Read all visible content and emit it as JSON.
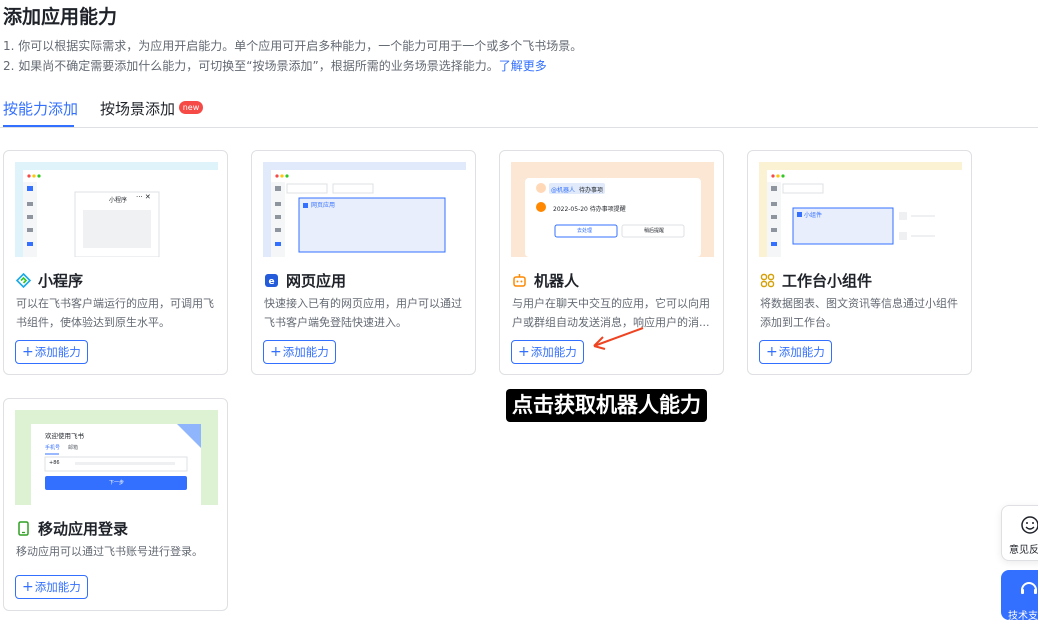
{
  "page": {
    "title": "添加应用能力",
    "desc_line1": "1. 你可以根据实际需求，为应用开启能力。单个应用可开启多种能力，一个能力可用于一个或多个飞书场景。",
    "desc_line2_prefix": "2. 如果尚不确定需要添加什么能力，可切换至“按场景添加”，根据所需的业务场景选择能力。",
    "desc_link": "了解更多"
  },
  "tabs": [
    {
      "label": "按能力添加",
      "active": true
    },
    {
      "label": "按场景添加",
      "active": false,
      "badge": "new"
    }
  ],
  "cards": [
    {
      "title": "小程序",
      "desc": "可以在飞书客户端运行的应用，可调用飞书组件，使体验达到原生水平。",
      "button": "添加能力",
      "icon": "mini-program-icon",
      "thumb_bg": "#dff3fb",
      "thumb": {
        "window_title": "小程序",
        "controls": "··· ✕"
      }
    },
    {
      "title": "网页应用",
      "desc": "快速接入已有的网页应用，用户可以通过飞书客户端免登陆快速进入。",
      "button": "添加能力",
      "icon": "web-app-icon",
      "thumb_bg": "#e1eafa",
      "thumb": {
        "tab_label": "网页应用"
      }
    },
    {
      "title": "机器人",
      "desc": "与用户在聊天中交互的应用，它可以向用户或群组自动发送消息，响应用户的消...",
      "button": "添加能力",
      "icon": "bot-icon",
      "thumb_bg": "#fce6d4",
      "thumb": {
        "header_tag": "@机器人",
        "header_text": "待办事项",
        "message": "2022-05-20 待办事项提醒",
        "btn_primary": "去处理",
        "btn_secondary": "稍后提醒"
      }
    },
    {
      "title": "工作台小组件",
      "desc": "将数据图表、图文资讯等信息通过小组件添加到工作台。",
      "button": "添加能力",
      "icon": "widget-icon",
      "thumb_bg": "#fbf1d3",
      "thumb": {
        "widget_label": "小组件"
      }
    },
    {
      "title": "移动应用登录",
      "desc": "移动应用可以通过飞书账号进行登录。",
      "button": "添加能力",
      "icon": "mobile-login-icon",
      "thumb_bg": "#dcf2d3",
      "thumb": {
        "welcome": "欢迎使用飞书",
        "tab_phone": "手机号",
        "tab_email": "邮箱",
        "country_code": "+86",
        "next_button": "下一步"
      }
    }
  ],
  "annotation": {
    "text": "点击获取机器人能力",
    "arrow_color": "#ee4422"
  },
  "floating": {
    "feedback_label": "意见反",
    "support_label": "技术支"
  },
  "colors": {
    "accent": "#3370ff",
    "badge": "#f54a45"
  }
}
